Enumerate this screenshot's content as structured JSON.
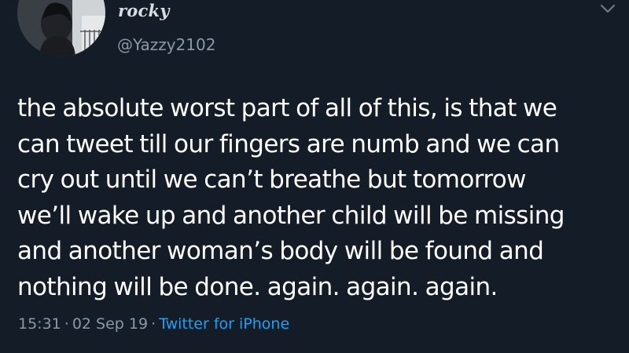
{
  "user": {
    "display_name": "rocky",
    "handle": "@Yazzy2102"
  },
  "tweet": {
    "lines": [
      "the absolute worst part of all of this, is that we",
      "can tweet till our fingers are numb and we can",
      "cry out until we can’t breathe but tomorrow",
      "we’ll wake up and another child will be missing",
      "and another woman’s body will be found and",
      "nothing will be done. again. again. again."
    ]
  },
  "meta": {
    "time": "15:31",
    "date": "02 Sep 19",
    "source": "Twitter for iPhone",
    "separator": "·"
  },
  "icons": {
    "menu": "chevron-down-icon"
  },
  "colors": {
    "background": "#141c27",
    "text": "#ffffff",
    "secondary": "#8b98a5",
    "link": "#1da1f2"
  }
}
